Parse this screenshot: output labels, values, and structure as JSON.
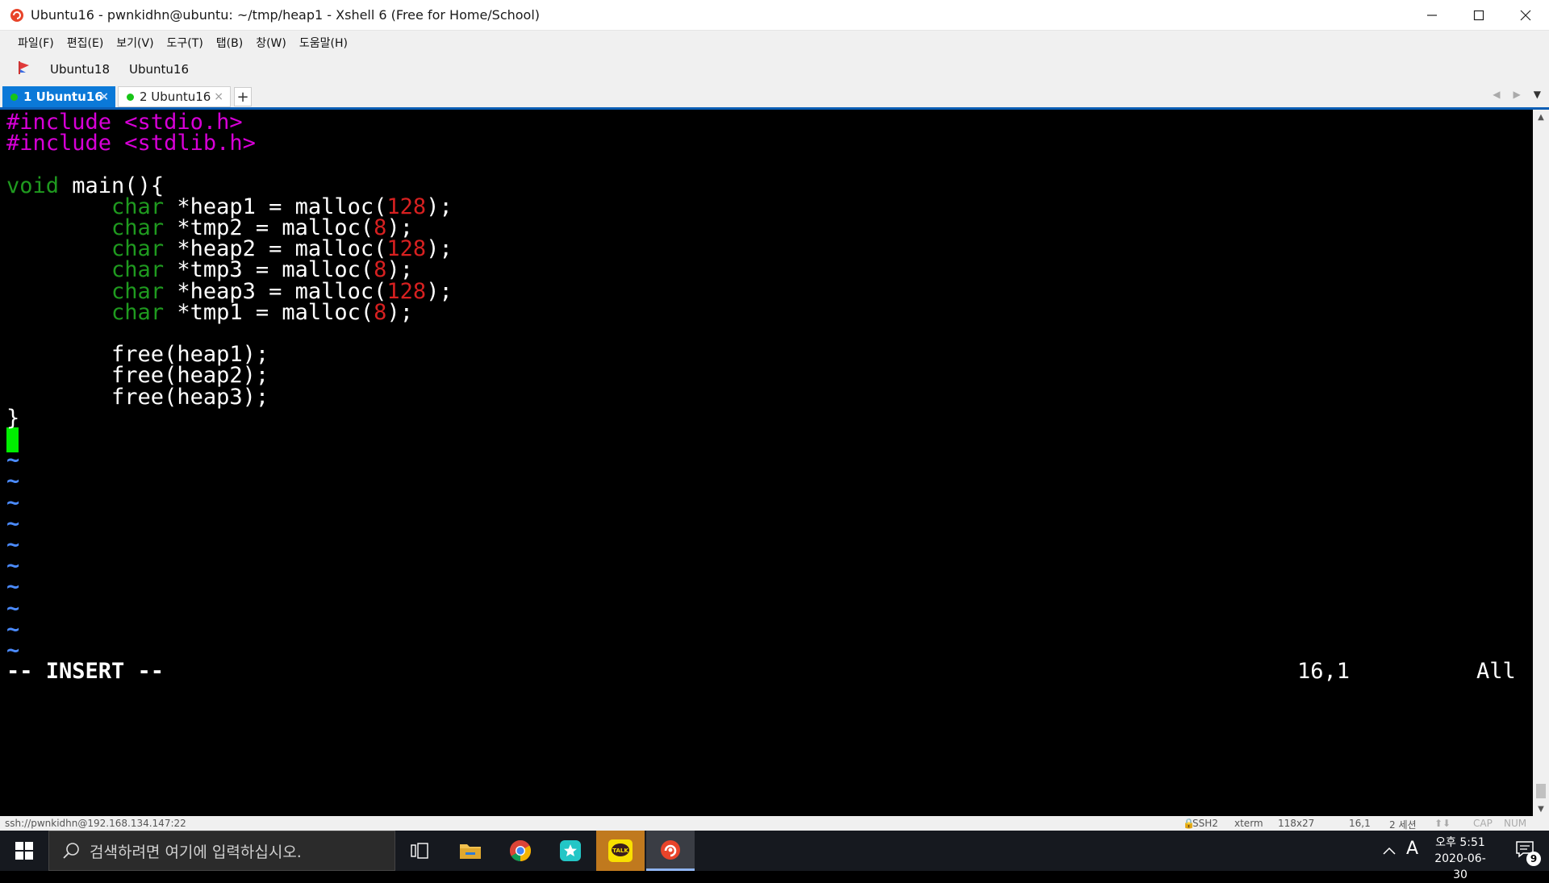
{
  "window": {
    "title": "Ubuntu16 - pwnkidhn@ubuntu: ~/tmp/heap1 - Xshell 6 (Free for Home/School)",
    "controls": {
      "minimize": "—",
      "maximize": "☐",
      "close": "✕"
    }
  },
  "menu": [
    "파일(F)",
    "편집(E)",
    "보기(V)",
    "도구(T)",
    "탭(B)",
    "창(W)",
    "도움말(H)"
  ],
  "links": [
    "Ubuntu18",
    "Ubuntu16"
  ],
  "tabs": [
    {
      "label": "1 Ubuntu16",
      "active": true,
      "close": "×"
    },
    {
      "label": "2 Ubuntu16",
      "active": false,
      "close": "×"
    }
  ],
  "tab_add": "+",
  "tab_nav": {
    "prev": "◀",
    "next": "▶",
    "menu": "▼"
  },
  "editor": {
    "lines": [
      [
        {
          "t": "#include <stdio.h>",
          "c": "pp"
        }
      ],
      [
        {
          "t": "#include <stdlib.h>",
          "c": "pp"
        }
      ],
      [],
      [
        {
          "t": "void",
          "c": "ty"
        },
        {
          "t": " main(){",
          "c": ""
        }
      ],
      [
        {
          "t": "        ",
          "c": ""
        },
        {
          "t": "char",
          "c": "ty"
        },
        {
          "t": " *heap1 = malloc(",
          "c": ""
        },
        {
          "t": "128",
          "c": "num"
        },
        {
          "t": ");",
          "c": ""
        }
      ],
      [
        {
          "t": "        ",
          "c": ""
        },
        {
          "t": "char",
          "c": "ty"
        },
        {
          "t": " *tmp2 = malloc(",
          "c": ""
        },
        {
          "t": "8",
          "c": "num"
        },
        {
          "t": ");",
          "c": ""
        }
      ],
      [
        {
          "t": "        ",
          "c": ""
        },
        {
          "t": "char",
          "c": "ty"
        },
        {
          "t": " *heap2 = malloc(",
          "c": ""
        },
        {
          "t": "128",
          "c": "num"
        },
        {
          "t": ");",
          "c": ""
        }
      ],
      [
        {
          "t": "        ",
          "c": ""
        },
        {
          "t": "char",
          "c": "ty"
        },
        {
          "t": " *tmp3 = malloc(",
          "c": ""
        },
        {
          "t": "8",
          "c": "num"
        },
        {
          "t": ");",
          "c": ""
        }
      ],
      [
        {
          "t": "        ",
          "c": ""
        },
        {
          "t": "char",
          "c": "ty"
        },
        {
          "t": " *heap3 = malloc(",
          "c": ""
        },
        {
          "t": "128",
          "c": "num"
        },
        {
          "t": ");",
          "c": ""
        }
      ],
      [
        {
          "t": "        ",
          "c": ""
        },
        {
          "t": "char",
          "c": "ty"
        },
        {
          "t": " *tmp1 = malloc(",
          "c": ""
        },
        {
          "t": "8",
          "c": "num"
        },
        {
          "t": ");",
          "c": ""
        }
      ],
      [],
      [
        {
          "t": "        free(heap1);",
          "c": ""
        }
      ],
      [
        {
          "t": "        free(heap2);",
          "c": ""
        }
      ],
      [
        {
          "t": "        free(heap3);",
          "c": ""
        }
      ],
      [
        {
          "t": "}",
          "c": ""
        }
      ]
    ],
    "tilde": "~",
    "tilde_count": 10,
    "mode": "-- INSERT --",
    "position": "16,1",
    "scroll": "All"
  },
  "statusbar": {
    "connection": "ssh://pwnkidhn@192.168.134.147:22",
    "protocol": "SSH2",
    "term": "xterm",
    "size": "118x27",
    "cursor": "16,1",
    "sessions": "2 세션",
    "caps": "CAP",
    "num": "NUM"
  },
  "taskbar": {
    "search_placeholder": "검색하려면 여기에 입력하십시오.",
    "clock_ampm_time": "오후 5:51",
    "clock_date": "2020-06-30",
    "ime": "A",
    "notification_count": "9",
    "apps": [
      "task-view",
      "file-explorer",
      "chrome",
      "bookmark-app",
      "kakaotalk",
      "xshell"
    ],
    "kakao_label": "TALK"
  },
  "colors": {
    "preprocessor": "#d700d7",
    "type": "#1f9a1f",
    "number": "#d72020",
    "tilde": "#4b8bff",
    "cursor": "#00ee00",
    "tab_active": "#0b79d8"
  }
}
